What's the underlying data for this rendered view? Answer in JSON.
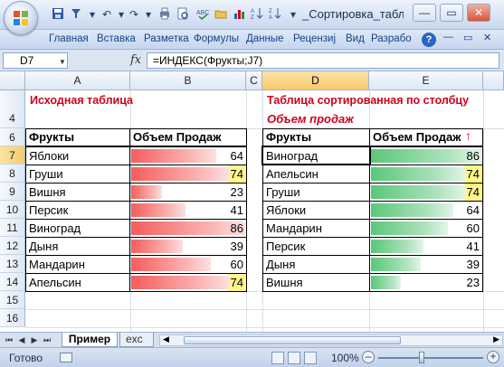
{
  "window": {
    "title": "_Сортировка_табли…",
    "controls": {
      "minimize": "—",
      "restore": "▭",
      "close": "✕"
    }
  },
  "ribbon": {
    "tabs": [
      "Главная",
      "Вставка",
      "Разметка",
      "Формулы",
      "Данные",
      "Рецензиј",
      "Вид",
      "Разрабо"
    ]
  },
  "formula_bar": {
    "name_box": "D7",
    "fx_label": "fx",
    "formula": "=ИНДЕКС(Фрукты;J7)"
  },
  "columns": [
    "A",
    "B",
    "C",
    "D",
    "E"
  ],
  "rows": [
    "4",
    "6",
    "7",
    "8",
    "9",
    "10",
    "11",
    "12",
    "13",
    "14",
    "15",
    "16"
  ],
  "left_table": {
    "title": "Исходная таблица",
    "header_fruit": "Фрукты",
    "header_sales": "Объем Продаж",
    "rows": [
      {
        "fruit": "Яблоки",
        "sales": "64",
        "value": 64
      },
      {
        "fruit": "Груши",
        "sales": "74",
        "value": 74
      },
      {
        "fruit": "Вишня",
        "sales": "23",
        "value": 23
      },
      {
        "fruit": "Персик",
        "sales": "41",
        "value": 41
      },
      {
        "fruit": "Виноград",
        "sales": "86",
        "value": 86
      },
      {
        "fruit": "Дыня",
        "sales": "39",
        "value": 39
      },
      {
        "fruit": "Мандарин",
        "sales": "60",
        "value": 60
      },
      {
        "fruit": "Апельсин",
        "sales": "74",
        "value": 74
      }
    ]
  },
  "right_table": {
    "title": "Таблица сортированная по столбцу",
    "subtitle": "Объем продаж",
    "header_fruit": "Фрукты",
    "header_sales": "Объем Продаж",
    "sort_indicator": "🡑",
    "rows": [
      {
        "fruit": "Виноград",
        "sales": "86",
        "value": 86
      },
      {
        "fruit": "Апельсин",
        "sales": "74",
        "value": 74
      },
      {
        "fruit": "Груши",
        "sales": "74",
        "value": 74
      },
      {
        "fruit": "Яблоки",
        "sales": "64",
        "value": 64
      },
      {
        "fruit": "Мандарин",
        "sales": "60",
        "value": 60
      },
      {
        "fruit": "Персик",
        "sales": "41",
        "value": 41
      },
      {
        "fruit": "Дыня",
        "sales": "39",
        "value": 39
      },
      {
        "fruit": "Вишня",
        "sales": "23",
        "value": 23
      }
    ]
  },
  "data_bar_max": 86,
  "highlight_value": 74,
  "colors": {
    "title_red": "#d0021b",
    "bar_red": "#f65c5c",
    "bar_green": "#5ac77a",
    "highlight_yellow": "#fff58c"
  },
  "sheet_tabs": [
    "Пример",
    "exc"
  ],
  "status": {
    "ready": "Готово",
    "zoom": "100%"
  }
}
